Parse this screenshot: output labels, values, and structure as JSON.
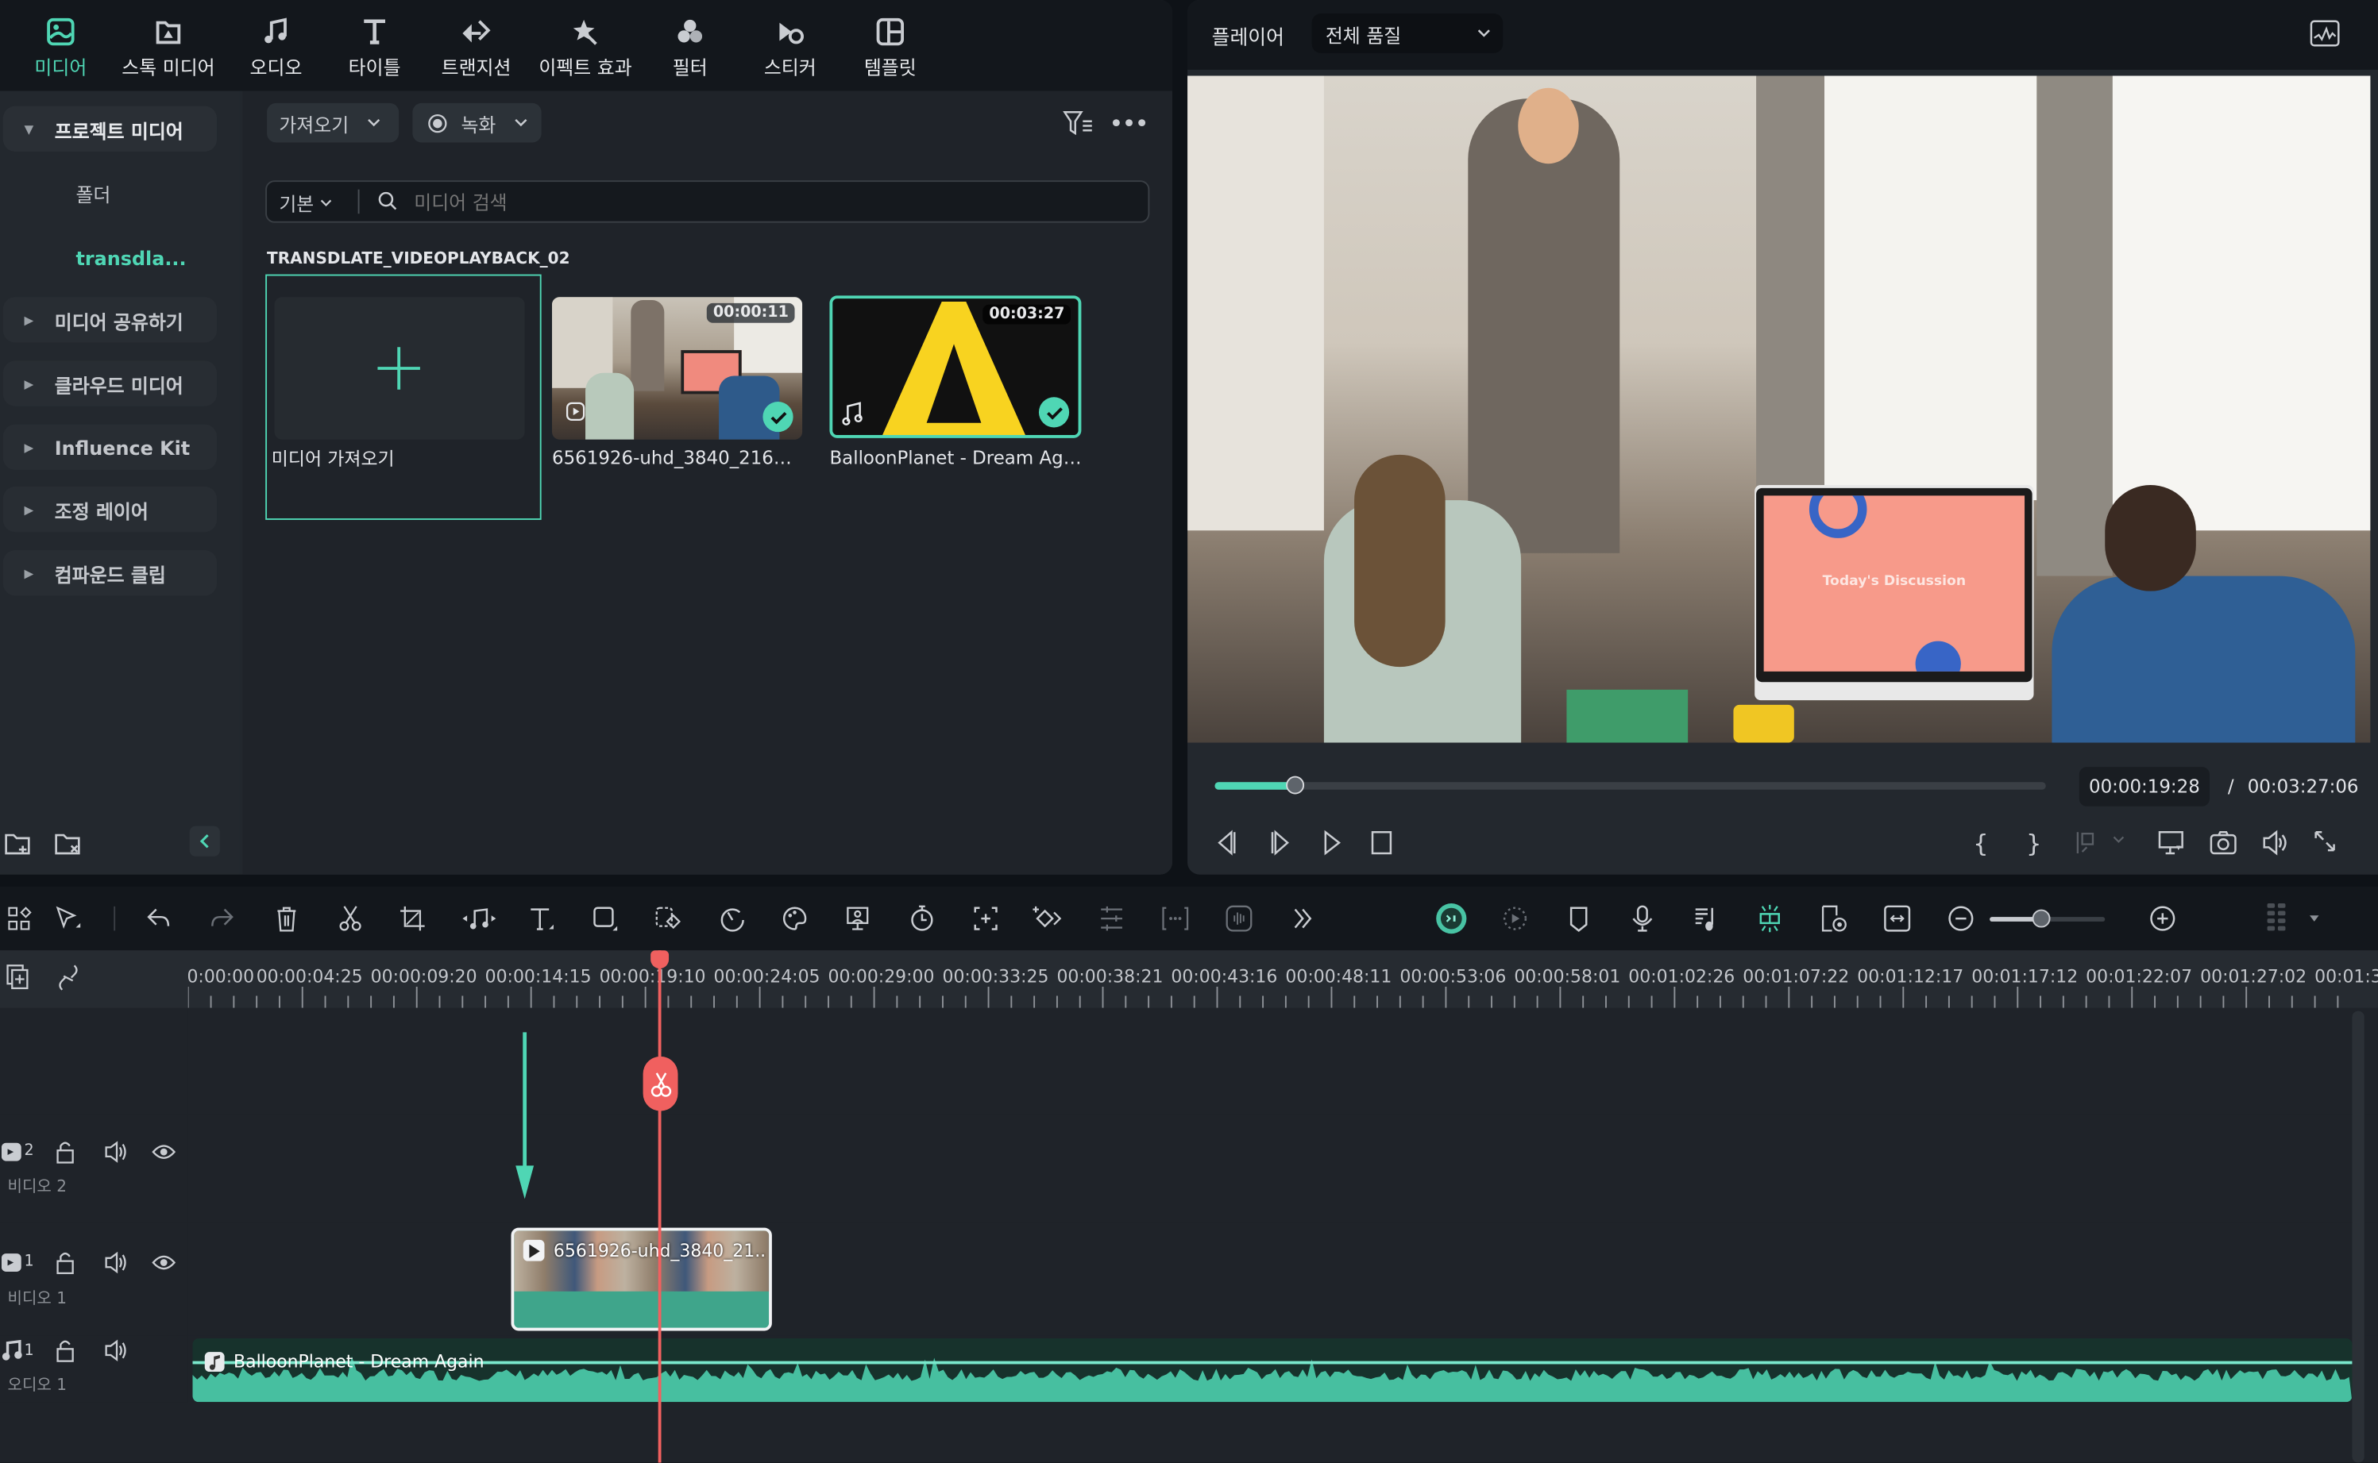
{
  "top_tabs": [
    {
      "label": "미디어",
      "icon": "media-icon",
      "active": true
    },
    {
      "label": "스톡 미디어",
      "icon": "stock-media-icon",
      "active": false
    },
    {
      "label": "오디오",
      "icon": "music-note-icon",
      "active": false
    },
    {
      "label": "타이틀",
      "icon": "title-text-icon",
      "active": false
    },
    {
      "label": "트랜지션",
      "icon": "transition-icon",
      "active": false
    },
    {
      "label": "이펙트 효과",
      "icon": "effects-star-icon",
      "active": false
    },
    {
      "label": "필터",
      "icon": "filter-circles-icon",
      "active": false
    },
    {
      "label": "스티커",
      "icon": "sticker-icon",
      "active": false
    },
    {
      "label": "템플릿",
      "icon": "template-icon",
      "active": false
    }
  ],
  "sidebar": {
    "project_media": "프로젝트 미디어",
    "folder": "폴더",
    "current_folder": "transdla...",
    "items": [
      {
        "label": "미디어 공유하기"
      },
      {
        "label": "클라우드 미디어"
      },
      {
        "label": "Influence Kit"
      },
      {
        "label": "조정 레이어"
      },
      {
        "label": "컴파운드 클립"
      }
    ]
  },
  "media_toolbar": {
    "import_label": "가져오기",
    "record_label": "녹화",
    "view_label": "기본",
    "search_placeholder": "미디어 검색"
  },
  "media_section_title": "TRANSDLATE_VIDEOPLAYBACK_02",
  "media_items": [
    {
      "title": "미디어 가져오기",
      "type": "import"
    },
    {
      "title": "6561926-uhd_3840_2160_2...",
      "duration": "00:00:11",
      "type": "video",
      "used": true
    },
    {
      "title": "BalloonPlanet - Dream Again",
      "duration": "00:03:27",
      "type": "audio",
      "used": true
    }
  ],
  "player": {
    "label": "플레이어",
    "quality": "전체 품질",
    "current_time": "00:00:19:28",
    "separator": "/",
    "total_time": "00:03:27:06",
    "progress_fraction": 0.096,
    "slide_text": "Today's Discussion"
  },
  "timeline": {
    "ruler_labels": [
      "00:00:00",
      "00:00:04:25",
      "00:00:09:20",
      "00:00:14:15",
      "00:00:19:10",
      "00:00:24:05",
      "00:00:29:00",
      "00:00:33:25",
      "00:00:38:21",
      "00:00:43:16",
      "00:00:48:11",
      "00:00:53:06",
      "00:00:58:01",
      "00:01:02:26",
      "00:01:07:22",
      "00:01:12:17",
      "00:01:17:12",
      "00:01:22:07",
      "00:01:27:02",
      "00:01:3"
    ],
    "zoom_level_fraction": 0.45,
    "tracks": [
      {
        "id": "video2",
        "number": "2",
        "label": "비디오 2"
      },
      {
        "id": "video1",
        "number": "1",
        "label": "비디오 1"
      },
      {
        "id": "audio1",
        "number": "1",
        "label": "오디오 1"
      }
    ],
    "video_clip_title": "6561926-uhd_3840_21...",
    "audio_clip_title": "BalloonPlanet - Dream Again"
  },
  "colors": {
    "accent": "#4fd6b4",
    "playhead": "#f0605f",
    "audio_wave": "#47bfa0"
  }
}
